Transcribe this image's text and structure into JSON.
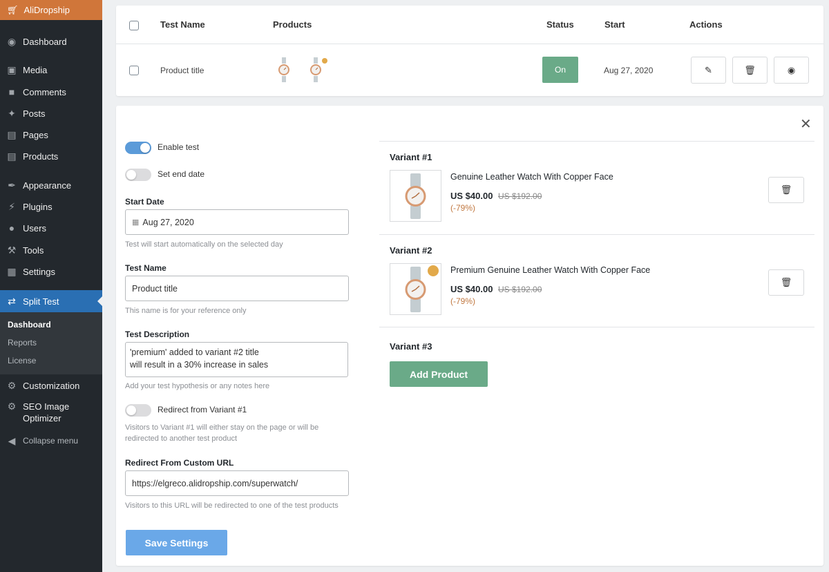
{
  "sidebar": {
    "brand": "AliDropship",
    "items": [
      {
        "label": "Dashboard",
        "icon": "dashboard-icon"
      },
      {
        "label": "Media",
        "icon": "media-icon"
      },
      {
        "label": "Comments",
        "icon": "comments-icon"
      },
      {
        "label": "Posts",
        "icon": "pin-icon"
      },
      {
        "label": "Pages",
        "icon": "pages-icon"
      },
      {
        "label": "Products",
        "icon": "cart-icon"
      },
      {
        "label": "Appearance",
        "icon": "brush-icon"
      },
      {
        "label": "Plugins",
        "icon": "plug-icon"
      },
      {
        "label": "Users",
        "icon": "user-icon"
      },
      {
        "label": "Tools",
        "icon": "wrench-icon"
      },
      {
        "label": "Settings",
        "icon": "settings-icon"
      },
      {
        "label": "Split Test",
        "icon": "shuffle-icon"
      },
      {
        "label": "Customization",
        "icon": "gear-icon"
      },
      {
        "label": "SEO Image Optimizer",
        "icon": "gear-icon"
      },
      {
        "label": "Collapse menu",
        "icon": "collapse-icon"
      }
    ],
    "submenu": [
      "Dashboard",
      "Reports",
      "License"
    ]
  },
  "table": {
    "headers": {
      "name": "Test Name",
      "products": "Products",
      "status": "Status",
      "start": "Start",
      "actions": "Actions"
    },
    "row": {
      "name": "Product title",
      "status": "On",
      "start": "Aug 27, 2020"
    }
  },
  "form": {
    "enable_test": "Enable test",
    "set_end_date": "Set end date",
    "start_date_label": "Start Date",
    "start_date_value": "Aug 27, 2020",
    "start_date_help": "Test will start automatically on the selected day",
    "test_name_label": "Test Name",
    "test_name_value": "Product title",
    "test_name_help": "This name is for your reference only",
    "desc_label": "Test Description",
    "desc_value": "'premium' added to variant #2 title\nwill result in a 30% increase in sales",
    "desc_help": "Add your test hypothesis or any notes here",
    "redirect_label": "Redirect from Variant #1",
    "redirect_help": "Visitors to Variant #1 will either stay on the page or will be redirected to another test product",
    "custom_url_label": "Redirect From Custom URL",
    "custom_url_value": "https://elgreco.alidropship.com/superwatch/",
    "custom_url_help": "Visitors to this URL will be redirected to one of the test products",
    "save": "Save Settings"
  },
  "variants": [
    {
      "label": "Variant #1",
      "name": "Genuine Leather Watch With Copper Face",
      "price": "US $40.00",
      "old_price": "US $192.00",
      "discount": "(-79%)"
    },
    {
      "label": "Variant #2",
      "name": "Premium Genuine Leather Watch With Copper Face",
      "price": "US $40.00",
      "old_price": "US $192.00",
      "discount": "(-79%)"
    },
    {
      "label": "Variant #3"
    }
  ],
  "add_product": "Add Product",
  "colors": {
    "sidebar_bg": "#23282d",
    "brand": "#d0763a",
    "active": "#2a6fb3",
    "status_on": "#6aaa88",
    "save": "#6aa8e8",
    "discount": "#c0773f"
  }
}
